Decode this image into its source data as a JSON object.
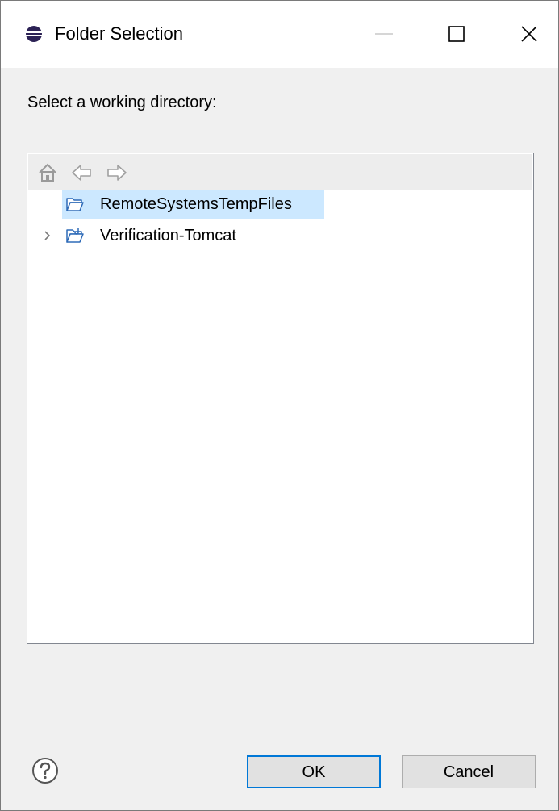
{
  "window": {
    "title": "Folder Selection",
    "icons": {
      "app": "eclipse-icon",
      "minimize": "minimize-icon",
      "maximize": "maximize-icon",
      "close": "close-icon"
    }
  },
  "prompt": "Select a working directory:",
  "toolbar": {
    "home_icon": "home-icon",
    "back_icon": "back-arrow-icon",
    "forward_icon": "forward-arrow-icon"
  },
  "tree": {
    "items": [
      {
        "label": "RemoteSystemsTempFiles",
        "icon": "open-folder-icon",
        "expandable": false,
        "selected": true
      },
      {
        "label": "Verification-Tomcat",
        "icon": "project-folder-icon",
        "expandable": true,
        "selected": false
      }
    ]
  },
  "buttons": {
    "help_icon": "help-icon",
    "ok": "OK",
    "cancel": "Cancel"
  },
  "colors": {
    "selection": "#cce8ff",
    "default_button_border": "#0078d7",
    "dialog_background": "#f0f0f0"
  }
}
